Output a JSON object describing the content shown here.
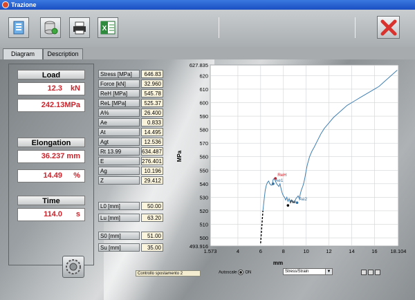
{
  "window": {
    "title": "Trazione"
  },
  "toolbar": {
    "buttons": [
      {
        "name": "open-button",
        "icon": "document-icon"
      },
      {
        "name": "save-button",
        "icon": "database-icon"
      },
      {
        "name": "print-button",
        "icon": "printer-icon"
      },
      {
        "name": "excel-button",
        "icon": "excel-icon"
      }
    ],
    "close_icon": "close-x-icon",
    "close_color": "#d8332f"
  },
  "tabs": [
    {
      "label": "Diagram",
      "active": true
    },
    {
      "label": "Description",
      "active": false
    }
  ],
  "readouts": {
    "load": {
      "title": "Load",
      "kn_value": "12.3",
      "kn_unit": "kN",
      "mpa_value": "242.13MPa"
    },
    "elongation": {
      "title": "Elongation",
      "mm_value": "36.237 mm",
      "pct_value": "14.49",
      "pct_unit": "%"
    },
    "time": {
      "title": "Time",
      "value": "114.0",
      "unit": "s"
    }
  },
  "params": [
    {
      "label": "Stress [MPa]",
      "value": "646.83"
    },
    {
      "label": "Force [kN]",
      "value": "32.960"
    },
    {
      "label": "ReH [MPa]",
      "value": "545.78"
    },
    {
      "label": "ReL [MPa]",
      "value": "525.37"
    },
    {
      "label": "A%",
      "value": "26.400"
    },
    {
      "label": "Ae",
      "value": "0.833"
    },
    {
      "label": "At",
      "value": "14.495"
    },
    {
      "label": "Agt",
      "value": "12.536"
    },
    {
      "label": "Rt 13.99",
      "value": "634.487"
    },
    {
      "label": "E",
      "value": "276.401"
    },
    {
      "label": "Ag",
      "value": "10.196"
    },
    {
      "label": "Z",
      "value": "29.412"
    }
  ],
  "dims": [
    {
      "label": "L0 [mm]",
      "value": "50.00"
    },
    {
      "label": "Lu [mm]",
      "value": "63.20"
    },
    {
      "label": "S0 [mm]",
      "value": "51.00"
    },
    {
      "label": "Su [mm]",
      "value": "35.00"
    }
  ],
  "status_text": "Controllo spostamento 2",
  "autoscale": {
    "label": "Autoscale",
    "state": "ON"
  },
  "plot_mode": "Stress/Strain",
  "chart_data": {
    "type": "line",
    "xlabel": "mm",
    "ylabel": "MPa",
    "xlim": [
      1.573,
      18.104
    ],
    "ylim": [
      493.916,
      627.835
    ],
    "x_ticks": [
      {
        "v": 1.573,
        "label": "1.573"
      },
      {
        "v": 4,
        "label": "4"
      },
      {
        "v": 6,
        "label": "6"
      },
      {
        "v": 8,
        "label": "8"
      },
      {
        "v": 10,
        "label": "10"
      },
      {
        "v": 12,
        "label": "12"
      },
      {
        "v": 14,
        "label": "14"
      },
      {
        "v": 16,
        "label": "16"
      },
      {
        "v": 18.104,
        "label": "18.104"
      }
    ],
    "y_ticks": [
      {
        "v": 493.916,
        "label": "493.916"
      },
      {
        "v": 500,
        "label": "500"
      },
      {
        "v": 510,
        "label": "510"
      },
      {
        "v": 520,
        "label": "520"
      },
      {
        "v": 530,
        "label": "530"
      },
      {
        "v": 540,
        "label": "540"
      },
      {
        "v": 550,
        "label": "550"
      },
      {
        "v": 560,
        "label": "560"
      },
      {
        "v": 570,
        "label": "570"
      },
      {
        "v": 580,
        "label": "580"
      },
      {
        "v": 590,
        "label": "590"
      },
      {
        "v": 600,
        "label": "600"
      },
      {
        "v": 610,
        "label": "610"
      },
      {
        "v": 620,
        "label": "620"
      },
      {
        "v": 627.835,
        "label": "627.835"
      }
    ],
    "grid": true,
    "series": [
      {
        "color": "#3f7fb2",
        "x": [
          6.2,
          6.3,
          6.4,
          6.5,
          6.6,
          6.7,
          6.8,
          6.9,
          7.0,
          7.1,
          7.2,
          7.3,
          7.4,
          7.5,
          7.6,
          7.7,
          7.8,
          7.9,
          8.0,
          8.1,
          8.2,
          8.3,
          8.4,
          8.5,
          8.6,
          8.7,
          8.8,
          8.9,
          9.0,
          9.1,
          9.2,
          9.3,
          9.4,
          9.5,
          9.6,
          9.7,
          9.8,
          9.9,
          10.0,
          10.1,
          10.2,
          10.3,
          10.5,
          10.7,
          11.0,
          11.3,
          11.6,
          12.0,
          12.4,
          12.8,
          13.2,
          13.6,
          14.0,
          14.4,
          14.8,
          15.2,
          15.6,
          16.0,
          16.4,
          16.8,
          17.2,
          17.6,
          18.0
        ],
        "y": [
          520,
          528,
          535,
          539,
          541,
          542,
          540,
          539,
          539,
          543,
          544,
          542,
          540,
          539,
          538,
          540,
          536,
          533,
          531,
          530,
          528,
          530,
          527,
          529,
          526,
          528,
          527,
          526,
          527,
          529,
          530,
          531,
          529,
          533,
          536,
          538,
          541,
          545,
          550,
          554,
          557,
          560,
          564,
          567,
          572,
          577,
          581,
          585,
          589,
          592,
          595,
          598,
          600,
          602,
          604,
          606,
          608,
          610,
          612,
          615,
          618,
          621,
          624
        ]
      },
      {
        "style": "dashed",
        "color": "#000000",
        "x": [
          6.0,
          6.2
        ],
        "y": [
          496,
          520
        ]
      }
    ],
    "annotations": [
      {
        "label": "ReH",
        "x": 7.3,
        "y": 544,
        "color": "#c8232b"
      },
      {
        "label": "Ae1",
        "x": 7.1,
        "y": 540,
        "color": "#2f6fa0"
      },
      {
        "label": "Re",
        "x": 8.4,
        "y": 524,
        "color": "#000000"
      },
      {
        "label": "Ae2",
        "x": 9.2,
        "y": 526,
        "color": "#2f6fa0"
      }
    ]
  }
}
